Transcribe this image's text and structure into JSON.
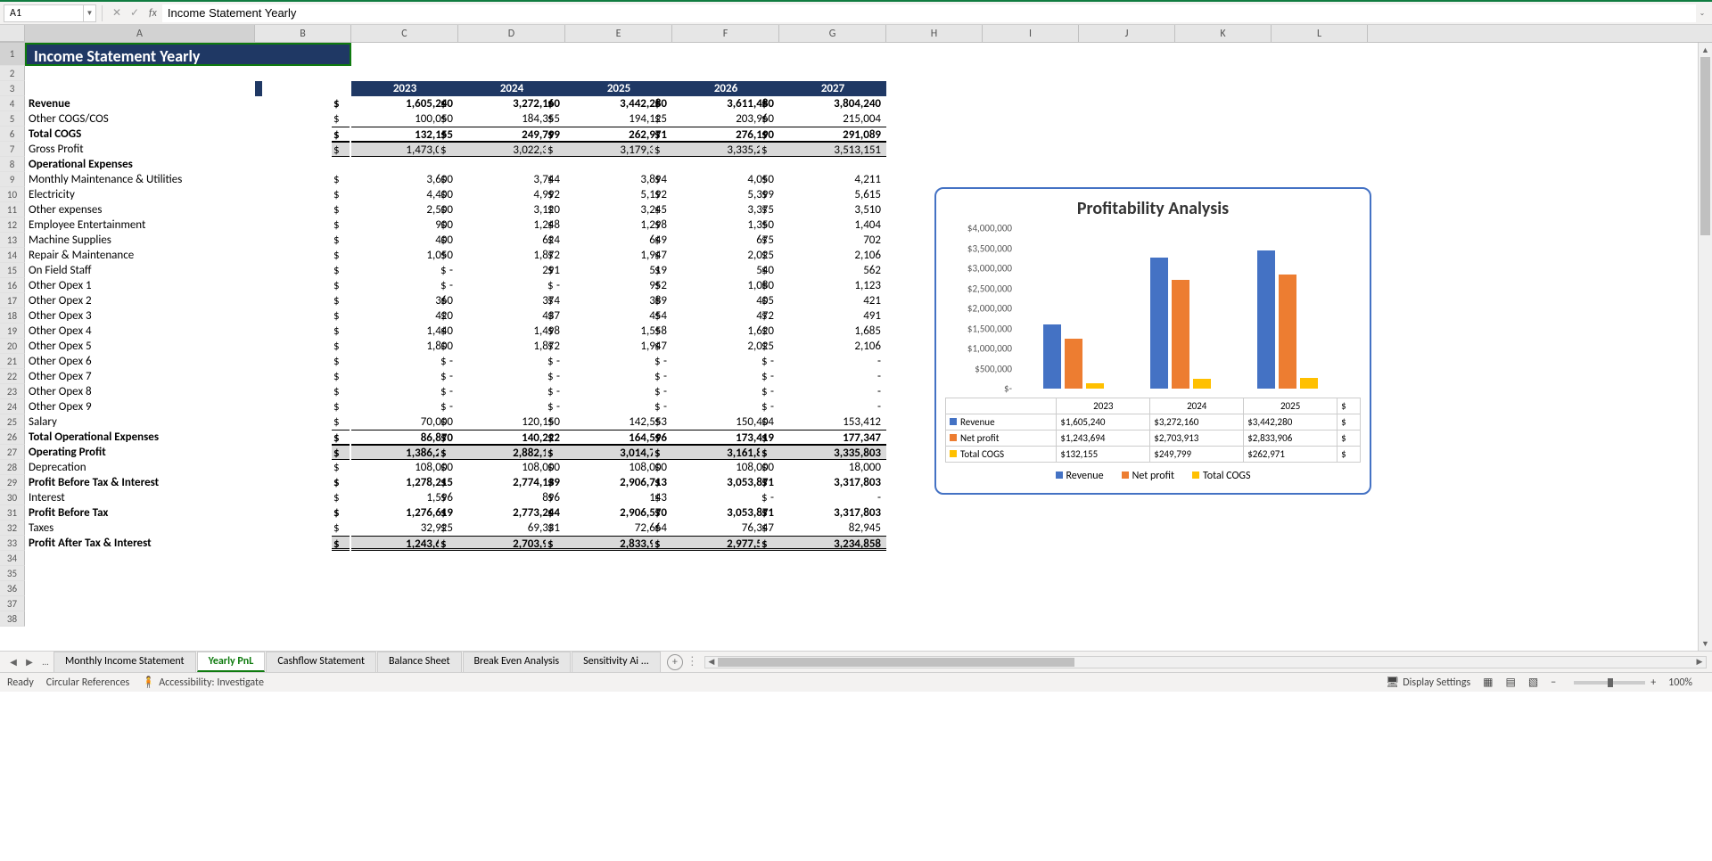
{
  "name_box": "A1",
  "formula_text": "Income Statement Yearly",
  "title": "Income Statement Yearly",
  "years": [
    "2023",
    "2024",
    "2025",
    "2026",
    "2027"
  ],
  "rows": [
    {
      "r": 4,
      "label": "Revenue",
      "bold": true,
      "vals": [
        "1,605,240",
        "3,272,160",
        "3,442,280",
        "3,611,480",
        "3,804,240"
      ]
    },
    {
      "r": 5,
      "label": "Other COGS/COS",
      "vals": [
        "100,050",
        "184,355",
        "194,125",
        "203,960",
        "215,004"
      ]
    },
    {
      "r": 6,
      "label": "Total COGS",
      "bold": true,
      "bt": true,
      "bb": true,
      "vals": [
        "132,155",
        "249,799",
        "262,971",
        "276,190",
        "291,089"
      ]
    },
    {
      "r": 7,
      "label": "Gross Profit",
      "bt": true,
      "bb": true,
      "shade": true,
      "vals": [
        "1,473,085",
        "3,022,361",
        "3,179,309",
        "3,335,290",
        "3,513,151"
      ]
    },
    {
      "r": 8,
      "label": "Operational Expenses",
      "bold": true
    },
    {
      "r": 9,
      "label": "Monthly Maintenance & Utilities",
      "vals": [
        "3,600",
        "3,744",
        "3,894",
        "4,050",
        "4,211"
      ]
    },
    {
      "r": 10,
      "label": "Electricity",
      "vals": [
        "4,400",
        "4,992",
        "5,192",
        "5,399",
        "5,615"
      ]
    },
    {
      "r": 11,
      "label": "Other expenses",
      "vals": [
        "2,500",
        "3,120",
        "3,245",
        "3,375",
        "3,510"
      ]
    },
    {
      "r": 12,
      "label": "Employee Entertainment",
      "vals": [
        "900",
        "1,248",
        "1,298",
        "1,350",
        "1,404"
      ]
    },
    {
      "r": 13,
      "label": "Machine Supplies",
      "vals": [
        "400",
        "624",
        "649",
        "675",
        "702"
      ]
    },
    {
      "r": 14,
      "label": "Repair & Maintenance",
      "vals": [
        "1,050",
        "1,872",
        "1,947",
        "2,025",
        "2,106"
      ]
    },
    {
      "r": 15,
      "label": "On Field Staff",
      "vals": [
        "-",
        "291",
        "519",
        "540",
        "562"
      ]
    },
    {
      "r": 16,
      "label": "Other Opex 1",
      "vals": [
        "-",
        "-",
        "952",
        "1,080",
        "1,123"
      ]
    },
    {
      "r": 17,
      "label": "Other Opex 2",
      "vals": [
        "360",
        "374",
        "389",
        "405",
        "421"
      ]
    },
    {
      "r": 18,
      "label": "Other Opex 3",
      "vals": [
        "420",
        "437",
        "454",
        "472",
        "491"
      ]
    },
    {
      "r": 19,
      "label": "Other Opex 4",
      "vals": [
        "1,440",
        "1,498",
        "1,558",
        "1,620",
        "1,685"
      ]
    },
    {
      "r": 20,
      "label": "Other Opex 5",
      "vals": [
        "1,800",
        "1,872",
        "1,947",
        "2,025",
        "2,106"
      ]
    },
    {
      "r": 21,
      "label": "Other Opex 6",
      "vals": [
        "-",
        "-",
        "-",
        "-",
        "-"
      ]
    },
    {
      "r": 22,
      "label": "Other Opex 7",
      "vals": [
        "-",
        "-",
        "-",
        "-",
        "-"
      ]
    },
    {
      "r": 23,
      "label": "Other Opex 8",
      "vals": [
        "-",
        "-",
        "-",
        "-",
        "-"
      ]
    },
    {
      "r": 24,
      "label": "Other Opex 9",
      "vals": [
        "-",
        "-",
        "-",
        "-",
        "-"
      ]
    },
    {
      "r": 25,
      "label": "Salary",
      "vals": [
        "70,000",
        "120,150",
        "142,553",
        "150,404",
        "153,412"
      ]
    },
    {
      "r": 26,
      "label": "Total Operational Expenses",
      "bold": true,
      "bt": true,
      "bb": true,
      "vals": [
        "86,870",
        "140,222",
        "164,596",
        "173,419",
        "177,347"
      ]
    },
    {
      "r": 27,
      "label": "Operating Profit",
      "bt": true,
      "bb": true,
      "shade": true,
      "bold": true,
      "vals": [
        "1,386,215",
        "2,882,139",
        "3,014,713",
        "3,161,871",
        "3,335,803"
      ]
    },
    {
      "r": 28,
      "label": "Deprecation",
      "vals": [
        "108,000",
        "108,000",
        "108,000",
        "108,000",
        "18,000"
      ]
    },
    {
      "r": 29,
      "label": "Profit Before Tax & Interest",
      "bold": true,
      "vals": [
        "1,278,215",
        "2,774,139",
        "2,906,713",
        "3,053,871",
        "3,317,803"
      ]
    },
    {
      "r": 30,
      "label": "Interest",
      "vals": [
        "1,596",
        "896",
        "143",
        "-",
        "-"
      ]
    },
    {
      "r": 31,
      "label": "Profit Before Tax",
      "bold": true,
      "vals": [
        "1,276,619",
        "2,773,244",
        "2,906,570",
        "3,053,871",
        "3,317,803"
      ]
    },
    {
      "r": 32,
      "label": "Taxes",
      "vals": [
        "32,925",
        "69,331",
        "72,664",
        "76,347",
        "82,945"
      ]
    },
    {
      "r": 33,
      "label": "Profit After Tax & Interest",
      "bold": true,
      "bt2": true,
      "bb2": true,
      "shade": true,
      "vals": [
        "1,243,694",
        "2,703,913",
        "2,833,906",
        "2,977,524",
        "3,234,858"
      ]
    }
  ],
  "chart_data": {
    "type": "bar",
    "title": "Profitability Analysis",
    "categories": [
      "2023",
      "2024",
      "2025"
    ],
    "ymax": 4000000,
    "yticks": [
      "$4,000,000",
      "$3,500,000",
      "$3,000,000",
      "$2,500,000",
      "$2,000,000",
      "$1,500,000",
      "$1,000,000",
      "$500,000",
      "$-"
    ],
    "series": [
      {
        "name": "Revenue",
        "color": "#4472c4",
        "values": [
          1605240,
          3272160,
          3442280
        ],
        "labels": [
          "$1,605,240",
          "$3,272,160",
          "$3,442,280"
        ]
      },
      {
        "name": "Net profit",
        "color": "#ed7d31",
        "values": [
          1243694,
          2703913,
          2833906
        ],
        "labels": [
          "$1,243,694",
          "$2,703,913",
          "$2,833,906"
        ]
      },
      {
        "name": "Total COGS",
        "color": "#ffc000",
        "values": [
          132155,
          249799,
          262971
        ],
        "labels": [
          "$132,155",
          "$249,799",
          "$262,971"
        ]
      }
    ]
  },
  "sheet_tabs": [
    "Monthly Income Statement",
    "Yearly PnL",
    "Cashflow Statement",
    "Balance Sheet",
    "Break Even Analysis",
    "Sensitivity Ai ..."
  ],
  "active_tab": 1,
  "status": {
    "ready": "Ready",
    "circular": "Circular References",
    "accessibility": "Accessibility: Investigate",
    "display": "Display Settings",
    "zoom": "100%"
  }
}
